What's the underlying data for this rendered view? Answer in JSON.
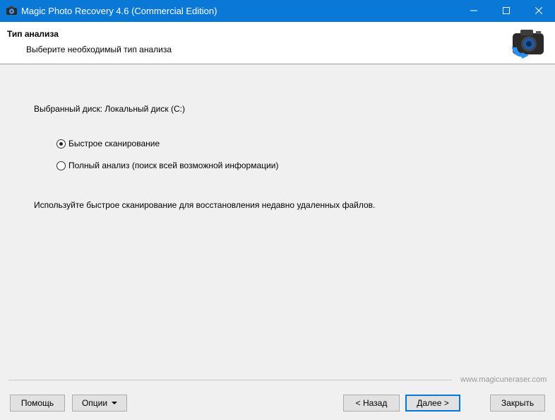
{
  "window": {
    "title": "Magic Photo Recovery 4.6 (Commercial Edition)"
  },
  "header": {
    "title": "Тип анализа",
    "subtitle": "Выберите необходимый тип анализа"
  },
  "content": {
    "disk_label": "Выбранный диск: Локальный диск (C:)",
    "options": [
      {
        "label": "Быстрое сканирование",
        "selected": true
      },
      {
        "label": "Полный анализ (поиск всей возможной информации)",
        "selected": false
      }
    ],
    "hint": "Используйте быстрое сканирование для восстановления недавно удаленных файлов."
  },
  "footer": {
    "website": "www.magicuneraser.com",
    "help_label": "Помощь",
    "options_label": "Опции",
    "back_label": "< Назад",
    "next_label": "Далее >",
    "close_label": "Закрыть"
  },
  "colors": {
    "titlebar": "#0a78d7",
    "accent": "#0078d7"
  }
}
